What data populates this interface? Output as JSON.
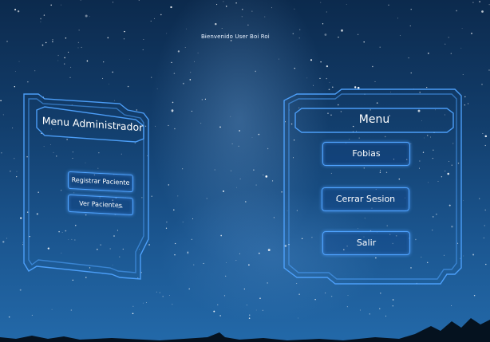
{
  "header": {
    "welcome_text": "Bienvenido User Boi Roi"
  },
  "admin_menu": {
    "title": "Menu Administrador",
    "buttons": {
      "register_patient": "Registrar Paciente",
      "view_patients": "Ver Pacientes"
    }
  },
  "main_menu": {
    "title": "Menu",
    "buttons": {
      "fobias": "Fobias",
      "logout": "Cerrar Sesion",
      "exit": "Salir"
    }
  },
  "colors": {
    "frame_glow": "#4fa3ff",
    "text": "#ffffff",
    "sky_top": "#0c2a4d",
    "sky_bottom": "#2369a9"
  }
}
